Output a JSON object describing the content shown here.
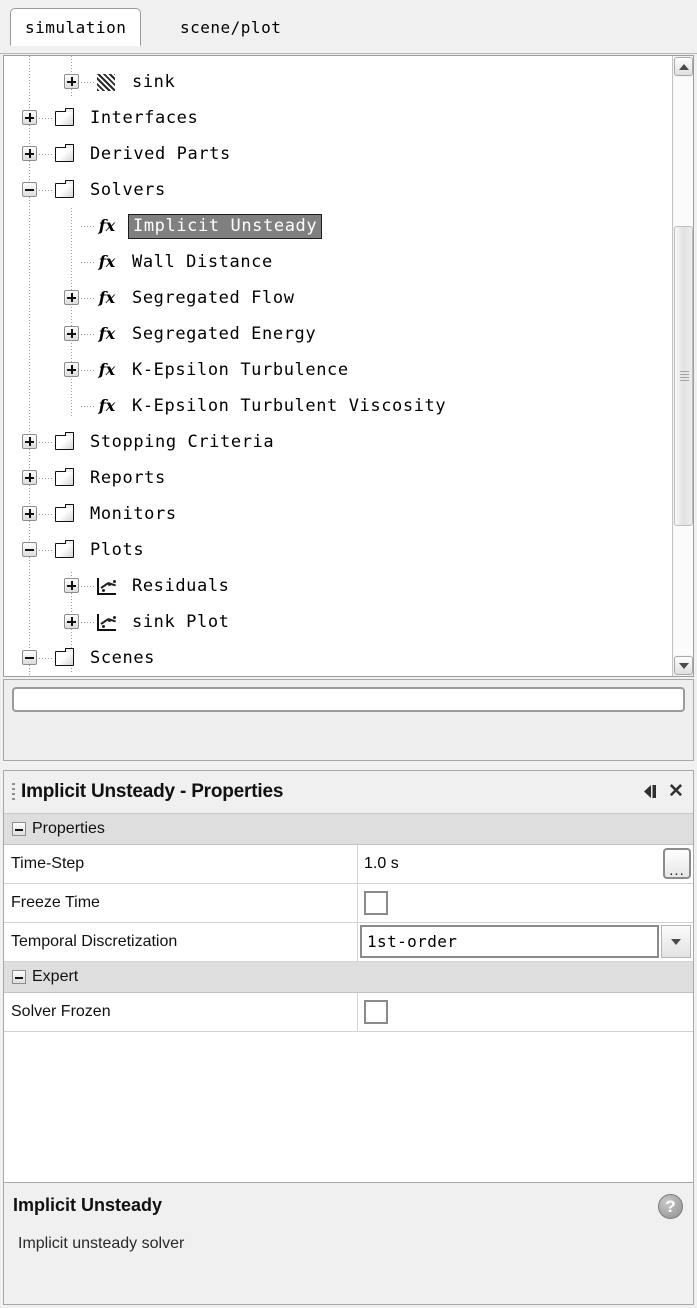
{
  "tabs": [
    {
      "label": "simulation",
      "active": true
    },
    {
      "label": "scene/plot",
      "active": false
    }
  ],
  "tree": {
    "nodes": [
      {
        "label": "sink",
        "icon": "region-hatch-icon",
        "depth": 1,
        "handle": "plus",
        "selected": false
      },
      {
        "label": "Interfaces",
        "icon": "folder-icon",
        "depth": 0,
        "handle": "plus",
        "selected": false
      },
      {
        "label": "Derived Parts",
        "icon": "folder-icon",
        "depth": 0,
        "handle": "plus",
        "selected": false
      },
      {
        "label": "Solvers",
        "icon": "folder-icon",
        "depth": 0,
        "handle": "minus",
        "selected": false
      },
      {
        "label": "Implicit Unsteady",
        "icon": "fx-icon",
        "depth": 1,
        "handle": "none",
        "selected": true
      },
      {
        "label": "Wall Distance",
        "icon": "fx-icon",
        "depth": 1,
        "handle": "none",
        "selected": false
      },
      {
        "label": "Segregated Flow",
        "icon": "fx-icon",
        "depth": 1,
        "handle": "plus",
        "selected": false
      },
      {
        "label": "Segregated Energy",
        "icon": "fx-icon",
        "depth": 1,
        "handle": "plus",
        "selected": false
      },
      {
        "label": "K-Epsilon Turbulence",
        "icon": "fx-icon",
        "depth": 1,
        "handle": "plus",
        "selected": false
      },
      {
        "label": "K-Epsilon Turbulent Viscosity",
        "icon": "fx-icon",
        "depth": 1,
        "handle": "none",
        "selected": false
      },
      {
        "label": "Stopping Criteria",
        "icon": "folder-icon",
        "depth": 0,
        "handle": "plus",
        "selected": false
      },
      {
        "label": "Reports",
        "icon": "folder-icon",
        "depth": 0,
        "handle": "plus",
        "selected": false
      },
      {
        "label": "Monitors",
        "icon": "folder-icon",
        "depth": 0,
        "handle": "plus",
        "selected": false
      },
      {
        "label": "Plots",
        "icon": "folder-icon",
        "depth": 0,
        "handle": "minus",
        "selected": false
      },
      {
        "label": "Residuals",
        "icon": "plot-icon",
        "depth": 1,
        "handle": "plus",
        "selected": false
      },
      {
        "label": "sink Plot",
        "icon": "plot-icon",
        "depth": 1,
        "handle": "plus",
        "selected": false
      },
      {
        "label": "Scenes",
        "icon": "folder-icon",
        "depth": 0,
        "handle": "minus",
        "selected": false
      }
    ],
    "scrollbar": {
      "up_icon": "chevron-up-icon",
      "down_icon": "chevron-down-icon"
    }
  },
  "filter": {
    "value": "",
    "placeholder": ""
  },
  "properties_window": {
    "title": "Implicit Unsteady - Properties",
    "minimize_icon": "collapse-panel-icon",
    "close_icon": "close-icon",
    "groups": [
      {
        "name": "Properties",
        "rows": [
          {
            "name": "Time-Step",
            "type": "text-ellipsis",
            "value": "1.0 s",
            "button_label": "...",
            "checked": false
          },
          {
            "name": "Freeze Time",
            "type": "checkbox",
            "value": "",
            "checked": false
          },
          {
            "name": "Temporal Discretization",
            "type": "combo",
            "value": "1st-order",
            "checked": false
          }
        ]
      },
      {
        "name": "Expert",
        "rows": [
          {
            "name": "Solver Frozen",
            "type": "checkbox",
            "value": "",
            "checked": false
          }
        ]
      }
    ]
  },
  "description": {
    "title": "Implicit Unsteady",
    "text": "Implicit unsteady solver",
    "help_icon": "help-icon",
    "help_glyph": "?"
  }
}
